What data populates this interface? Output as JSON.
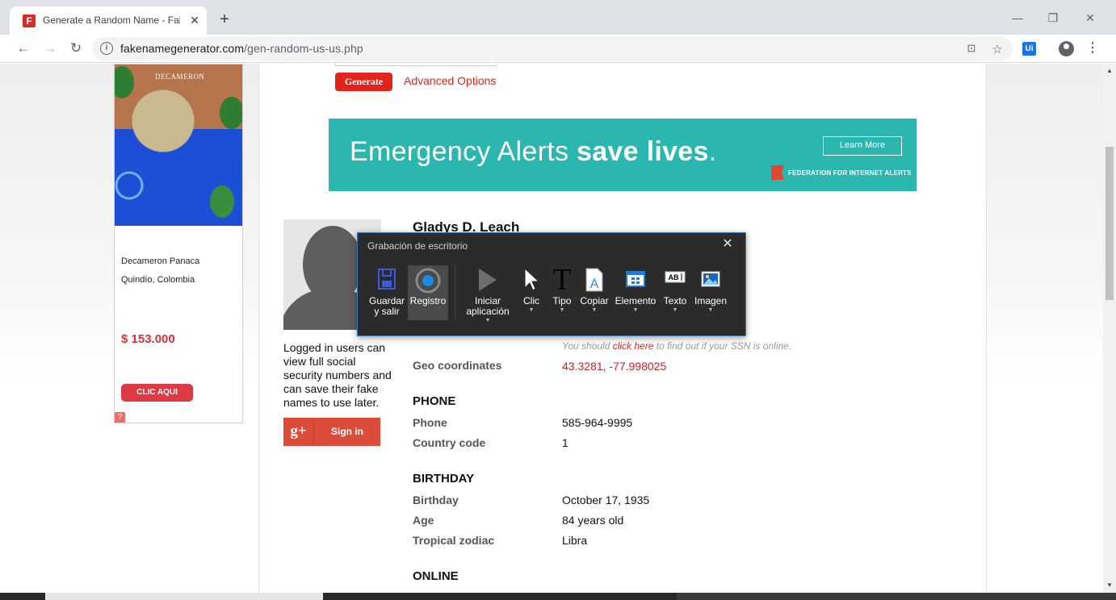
{
  "browser": {
    "tab_title": "Generate a Random Name - Fake",
    "tab_favicon": "F",
    "url_domain": "fakenamegenerator.com",
    "url_path": "/gen-random-us-us.php"
  },
  "side_ad": {
    "logo": "DECAMERON",
    "hotel": "Decameron Panaca",
    "location": "Quindío, Colombia",
    "price": "$ 153.000",
    "button": "CLIC AQUI",
    "help": "?"
  },
  "form": {
    "generate_label": "Generate",
    "advanced_label": "Advanced Options"
  },
  "banner": {
    "headline_light": "Emergency Alerts ",
    "headline_bold": "save lives",
    "headline_end": ".",
    "button": "Learn More",
    "org": "FEDERATION FOR INTERNET ALERTS"
  },
  "profile": {
    "name": "Gladys D. Leach",
    "login_note": "Logged in users can view full social security numbers and can save their fake names to use later.",
    "gplus_icon": "g+",
    "gplus_label": "Sign in",
    "ssn_prefix": "You should ",
    "ssn_link": "click here",
    "ssn_suffix": " to find out if your SSN is online.",
    "geo_label": "Geo coordinates",
    "geo_value": "43.3281, -77.998025",
    "phone_section": "PHONE",
    "phone_label": "Phone",
    "phone_value": "585-964-9995",
    "cc_label": "Country code",
    "cc_value": "1",
    "birthday_section": "BIRTHDAY",
    "birthday_label": "Birthday",
    "birthday_value": "October 17, 1935",
    "age_label": "Age",
    "age_value": "84 years old",
    "zodiac_label": "Tropical zodiac",
    "zodiac_value": "Libra",
    "online_section": "ONLINE"
  },
  "recorder": {
    "title": "Grabación de escritorio",
    "buttons": {
      "save": "Guardar y salir",
      "record": "Registro",
      "start_app": "Iniciar aplicación",
      "click": "Clic",
      "type": "Tipo",
      "copy": "Copiar",
      "element": "Elemento",
      "text": "Texto",
      "image": "Imagen"
    }
  }
}
